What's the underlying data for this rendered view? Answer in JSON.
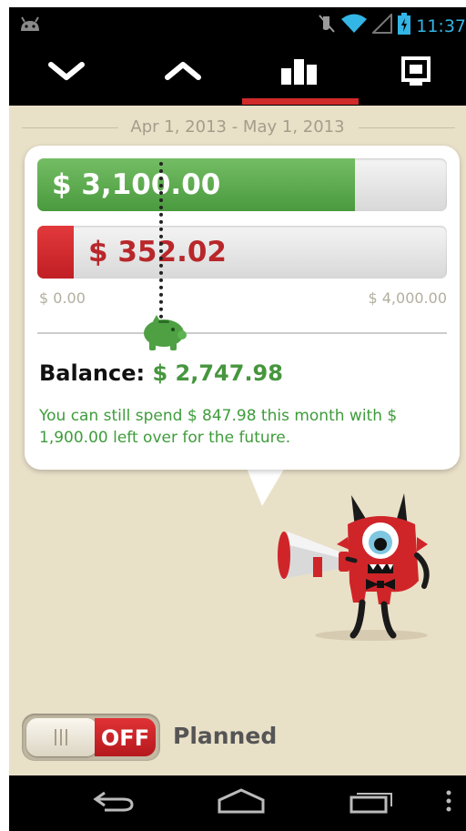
{
  "status_bar": {
    "time": "11:37",
    "icons": [
      "android-notification-icon",
      "mute-icon",
      "wifi-icon",
      "signal-icon",
      "battery-icon"
    ]
  },
  "toolbar": {
    "buttons": [
      {
        "name": "expenses-down-icon"
      },
      {
        "name": "income-up-icon"
      },
      {
        "name": "overview-chart-icon",
        "selected": true
      },
      {
        "name": "details-icon"
      }
    ]
  },
  "date_range": "Apr 1, 2013 - May 1, 2013",
  "budget": {
    "income_label": "$ 3,100.00",
    "expense_label": "$ 352.02",
    "scale_min": "$ 0.00",
    "scale_max": "$ 4,000.00",
    "income_fraction": 0.775,
    "expense_fraction": 0.088
  },
  "balance": {
    "label": "Balance:",
    "value": "$ 2,747.98"
  },
  "advice_text": "You can still spend $ 847.98 this month with $ 1,900.00 left over for the future.",
  "planned_toggle": {
    "state_label": "OFF",
    "label": "Planned"
  },
  "nav_bar": {
    "buttons": [
      "back-icon",
      "home-icon",
      "recent-apps-icon",
      "overflow-menu-icon"
    ]
  },
  "colors": {
    "accent_red": "#d12a2a",
    "income_green": "#47963f",
    "background": "#e9e0c8",
    "system_blue": "#33b5e5"
  }
}
